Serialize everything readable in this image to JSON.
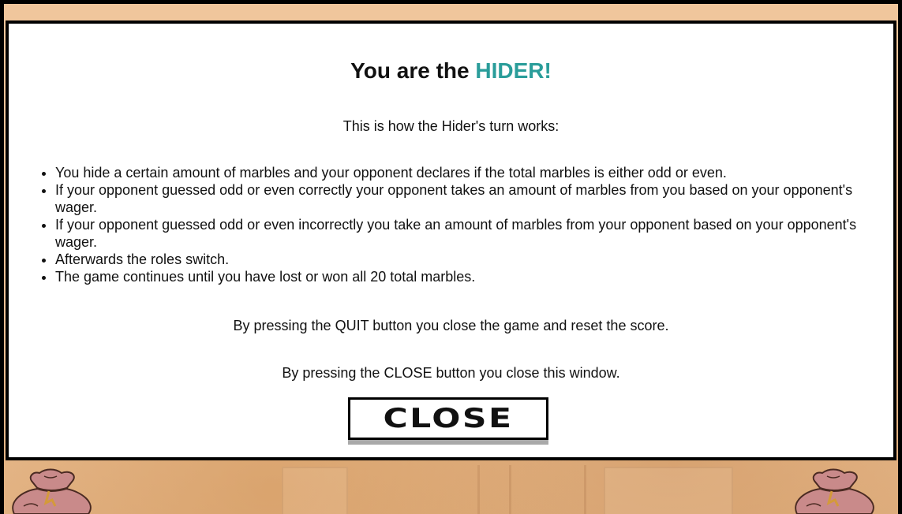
{
  "modal": {
    "title_prefix": "You are the",
    "title_role": "HIDER!",
    "intro": "This is how the Hider's turn works:",
    "rules": [
      "You hide a certain amount of marbles and your opponent declares if the total marbles is either odd or even.",
      "If your opponent guessed odd or even correctly your opponent takes an amount of marbles from you based on your opponent's wager.",
      "If your opponent guessed odd or even incorrectly you take an amount of marbles from your opponent based on your opponent's wager.",
      "Afterwards the roles switch.",
      "The game continues until you have lost or won all 20 total marbles."
    ],
    "quit_note": "By pressing the QUIT button you close the game and reset the score.",
    "close_note": "By pressing the CLOSE button you close this window.",
    "close_button_label": "CLOSE"
  },
  "background": {
    "left_icon": "marble-bag-icon",
    "right_icon": "marble-bag-icon"
  },
  "colors": {
    "role_highlight": "#2a9d9a",
    "background": "#f0c69c",
    "bag": "#c98a8a"
  }
}
